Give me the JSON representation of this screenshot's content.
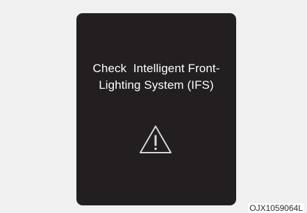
{
  "warning": {
    "line1": "Check  Intelligent Front-",
    "line2": "Lighting System (IFS)",
    "icon": "warning-triangle-icon"
  },
  "caption": "OJX1059064L",
  "colors": {
    "background": "#f0f0f0",
    "panel": "#231f20",
    "text": "#ffffff",
    "icon": "#d8d8d8"
  }
}
